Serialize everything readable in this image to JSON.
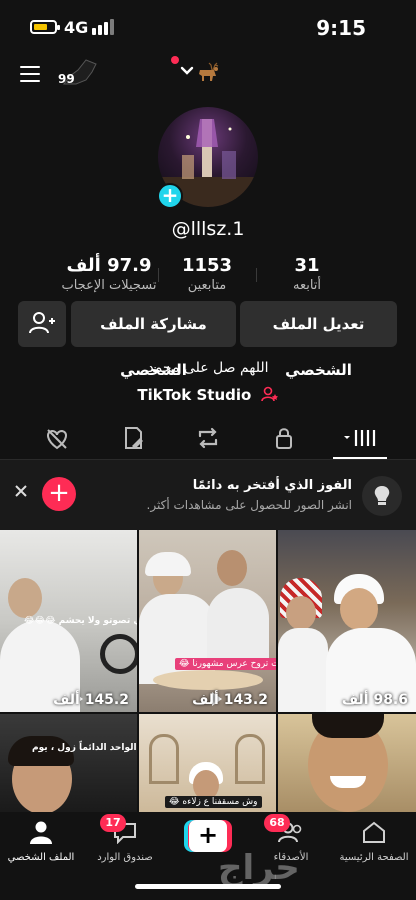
{
  "status_bar": {
    "network": "4G",
    "time": "9:15"
  },
  "top_bar": {
    "streak_count": "99"
  },
  "profile": {
    "username": "@lllsz.1",
    "stats": {
      "following": {
        "value": "31",
        "label": "أتابعه"
      },
      "followers": {
        "value": "1153",
        "label": "متابعين"
      },
      "likes": {
        "value": "97.9 ألف",
        "label": "تسجيلات الإعجاب"
      }
    },
    "buttons": {
      "edit_profile": "تعديل الملف الشخصي",
      "share_profile": "مشاركة الملف الشخصي"
    },
    "bio": "اللهم صل على محمد",
    "studio_link": "TikTok Studio"
  },
  "tabs": [
    "videos",
    "private",
    "reposts",
    "favorites",
    "liked"
  ],
  "promo": {
    "title": "الفوز الذي أفتخر به دائمًا",
    "subtitle": "انشر الصور للحصول على مشاهدات أكثر."
  },
  "videos": [
    {
      "views": "145.2 ألف",
      "caption": "ابا صحيح صوتي تصوتو ولا يحشم 😂😂😂"
    },
    {
      "views": "143.2 ألف",
      "caption": "وقت تروح عرس مشهورنا 😂"
    },
    {
      "views": "98.6 ألف",
      "caption": ""
    },
    {
      "views": "",
      "caption": "الواحد الدائماً زول ، يوم"
    },
    {
      "views": "",
      "caption": "وش مسقفنا ع زلاءه 😂"
    },
    {
      "views": "",
      "caption": ""
    }
  ],
  "bottom_nav": {
    "home": "الصفحة الرئيسية",
    "friends": "الأصدقاء",
    "inbox": "صندوق الوارد",
    "profile": "الملف الشخصي",
    "friends_badge": "68",
    "inbox_badge": "17"
  },
  "watermark": "حراج",
  "colors": {
    "accent_pink": "#fe2c55",
    "accent_cyan": "#20d5ec",
    "background": "#121212"
  }
}
